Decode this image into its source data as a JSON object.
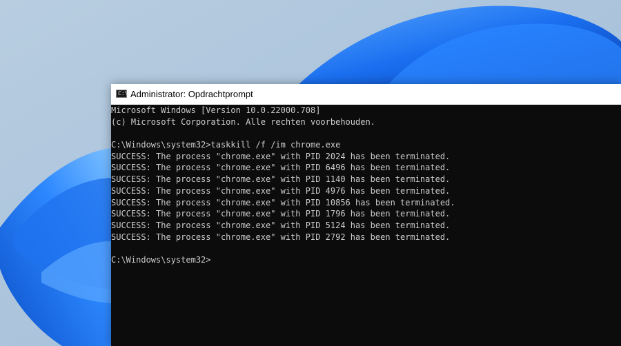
{
  "window": {
    "title": "Administrator: Opdrachtprompt"
  },
  "console": {
    "lines": [
      "Microsoft Windows [Version 10.0.22000.708]",
      "(c) Microsoft Corporation. Alle rechten voorbehouden.",
      "",
      "C:\\Windows\\system32>taskkill /f /im chrome.exe",
      "SUCCESS: The process \"chrome.exe\" with PID 2024 has been terminated.",
      "SUCCESS: The process \"chrome.exe\" with PID 6496 has been terminated.",
      "SUCCESS: The process \"chrome.exe\" with PID 1140 has been terminated.",
      "SUCCESS: The process \"chrome.exe\" with PID 4976 has been terminated.",
      "SUCCESS: The process \"chrome.exe\" with PID 10856 has been terminated.",
      "SUCCESS: The process \"chrome.exe\" with PID 1796 has been terminated.",
      "SUCCESS: The process \"chrome.exe\" with PID 5124 has been terminated.",
      "SUCCESS: The process \"chrome.exe\" with PID 2792 has been terminated.",
      "",
      "C:\\Windows\\system32>"
    ]
  },
  "colors": {
    "console_bg": "#0c0c0c",
    "console_text": "#cccccc",
    "titlebar_bg": "#ffffff",
    "wallpaper_accent": "#1565e0"
  },
  "icons": {
    "app": "command-prompt-icon"
  }
}
